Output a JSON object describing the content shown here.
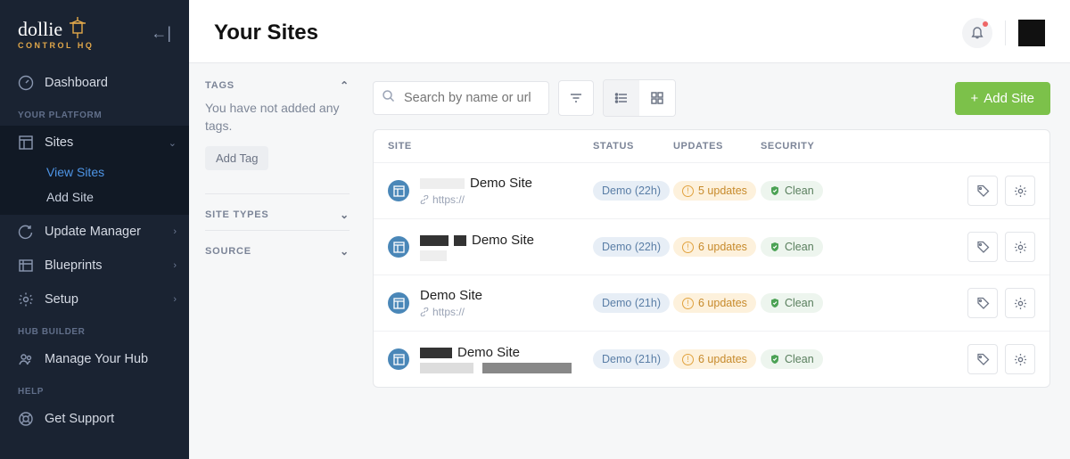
{
  "brand": {
    "name": "dollie",
    "subtitle": "CONTROL HQ"
  },
  "sidebar": {
    "dashboard": "Dashboard",
    "headings": {
      "platform": "YOUR PLATFORM",
      "hub": "HUB BUILDER",
      "help": "HELP"
    },
    "sites": "Sites",
    "view_sites": "View Sites",
    "add_site": "Add Site",
    "update_manager": "Update Manager",
    "blueprints": "Blueprints",
    "setup": "Setup",
    "manage_hub": "Manage Your Hub",
    "get_support": "Get Support"
  },
  "header": {
    "title": "Your Sites"
  },
  "filters": {
    "tags_label": "TAGS",
    "no_tags": "You have not added any tags.",
    "add_tag": "Add Tag",
    "site_types": "SITE TYPES",
    "source": "SOURCE"
  },
  "toolbar": {
    "search_placeholder": "Search by name or url",
    "add_site": "Add Site"
  },
  "columns": {
    "site": "SITE",
    "status": "STATUS",
    "updates": "UPDATES",
    "security": "SECURITY"
  },
  "rows": [
    {
      "name": "Demo Site",
      "url": "https://",
      "status": "Demo (22h)",
      "updates": "5 updates",
      "security": "Clean"
    },
    {
      "name": "Demo Site",
      "url": "",
      "status": "Demo (22h)",
      "updates": "6 updates",
      "security": "Clean"
    },
    {
      "name": "Demo Site",
      "url": "https://",
      "status": "Demo (21h)",
      "updates": "6 updates",
      "security": "Clean"
    },
    {
      "name": "Demo Site",
      "url": "",
      "status": "Demo (21h)",
      "updates": "6 updates",
      "security": "Clean"
    }
  ]
}
